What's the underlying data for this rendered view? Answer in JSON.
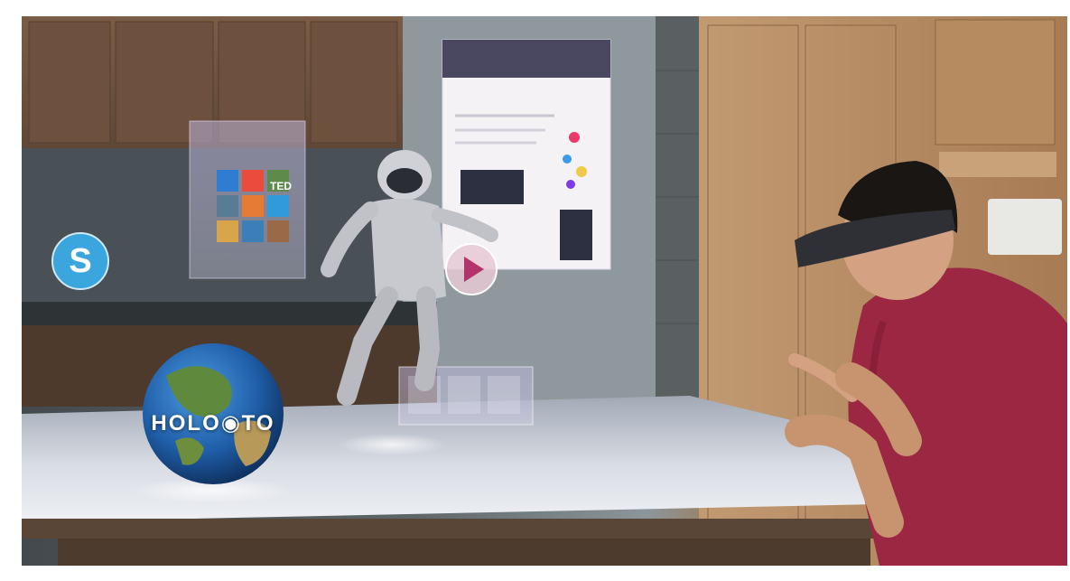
{
  "scene": {
    "globe_text": "HOLO◉TO",
    "skype_letter": "S",
    "app_tile_text": "TED",
    "colors": {
      "wall_dark": "#43494d",
      "wood": "#b88f66",
      "hologram_glow": "#d8d4ef",
      "shirt": "#9b2743",
      "table_top": "#d9dde4"
    }
  }
}
